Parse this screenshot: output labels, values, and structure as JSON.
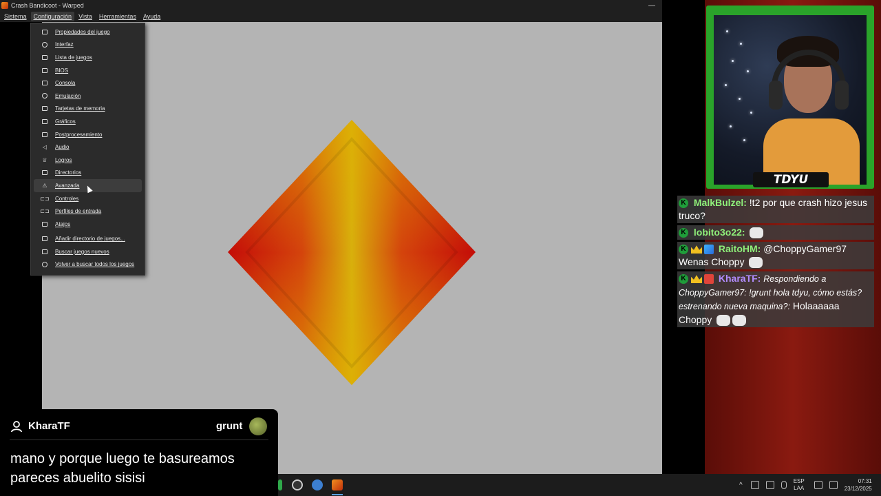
{
  "window": {
    "title": "Crash Bandicoot - Warped",
    "minimize": "—",
    "maximize": "❐",
    "close": "✕"
  },
  "menubar": [
    "Sistema",
    "Configuración",
    "Vista",
    "Herramientas",
    "Ayuda"
  ],
  "dropdown": {
    "items": [
      {
        "label": "Propiedades del juego",
        "icon": "game-properties-icon"
      },
      {
        "label": "Interfaz",
        "icon": "interface-gear-icon"
      },
      {
        "label": "Lista de juegos",
        "icon": "folder-icon"
      },
      {
        "label": "BIOS",
        "icon": "chip-icon"
      },
      {
        "label": "Consola",
        "icon": "console-icon"
      },
      {
        "label": "Emulación",
        "icon": "gear-icon"
      },
      {
        "label": "Tarjetas de memoria",
        "icon": "memory-card-icon"
      },
      {
        "label": "Gráficos",
        "icon": "image-icon"
      },
      {
        "label": "Postprocesamiento",
        "icon": "postprocessing-icon"
      },
      {
        "label": "Audio",
        "icon": "speaker-icon"
      },
      {
        "label": "Logros",
        "icon": "trophy-icon"
      },
      {
        "label": "Directorios",
        "icon": "folder-icon"
      },
      {
        "label": "Avanzada",
        "icon": "warning-icon"
      },
      {
        "label": "Controles",
        "icon": "gamepad-icon"
      },
      {
        "label": "Perfiles de entrada",
        "icon": "gamepad-icon"
      },
      {
        "label": "Atajos",
        "icon": "keyboard-icon"
      },
      {
        "label": "Añadir directorio de juegos...",
        "icon": "add-folder-icon"
      },
      {
        "label": "Buscar juegos nuevos",
        "icon": "search-folder-icon"
      },
      {
        "label": "Volver a buscar todos los juegos",
        "icon": "refresh-icon"
      }
    ]
  },
  "webcam": {
    "name_tag": "TDYU"
  },
  "chat": {
    "messages": [
      {
        "user": "MalkBulzel:",
        "text": "!t2 por que crash hizo jesus truco?"
      },
      {
        "user": "lobito3o22:",
        "text": ""
      },
      {
        "user": "RaitoHM:",
        "text": "@ChoppyGamer97 Wenas Choppy"
      },
      {
        "user": "KharaTF:",
        "text_italic": "Respondiendo a ChoppyGamer97: !grunt hola tdyu, cómo estás? estrenando nueva maquina?:",
        "text": "Holaaaaaa Choppy"
      }
    ]
  },
  "alert": {
    "user": "KharaTF",
    "command": "grunt",
    "message": "mano y porque luego te basureamos pareces abuelito sisisi"
  },
  "taskbar": {
    "lang_1": "ESP",
    "lang_2": "LAA",
    "time": "07:31",
    "date": "23/12/2025"
  },
  "colors": {
    "game_background": "#b4b4b4",
    "menu_background": "#2b2b2b",
    "webcam_frame": "#2aa32a",
    "chat_name_green": "#8ff07a",
    "chat_name_purple": "#b28cff"
  }
}
